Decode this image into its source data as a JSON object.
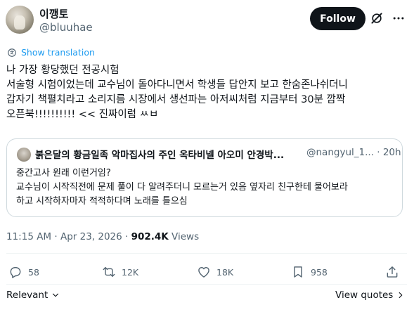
{
  "author": {
    "display_name": "이깽토",
    "handle": "@bluuhae"
  },
  "follow_label": "Follow",
  "translation_label": "Show translation",
  "tweet_lines": [
    "나 가장 황당했던 전공시험",
    "서술형 시험이었는데 교수님이 돌아다니면서 학생들 답안지 보고 한숨존나쉬더니",
    "갑자기 책펼치라고 소리지름 시장에서 생선파는 아저씨처럼 지금부터 30분 깜짝",
    "오픈북!!!!!!!!!! << 진짜이럼 ㅆㅂ"
  ],
  "quote": {
    "author": "붉은달의 황금일족 악마집사의 주인 옥타비넬 아오미 안경박...",
    "handle_time": "@nangyul_1... · 20h",
    "lines": [
      "중간고사 원래 이런거임?",
      "교수님이 시작직전에 문제 풀이 다 알려주더니 모르는거 있음 옆자리 친구한테 물어보라",
      "하고 시작하자마자 적적하다며 노래를 틀으심"
    ]
  },
  "meta": {
    "timestamp": "11:15 AM · Apr 23, 2026 · ",
    "views_count": "902.4K",
    "views_label": " Views"
  },
  "actions": {
    "replies": "58",
    "reposts": "12K",
    "likes": "18K",
    "bookmarks": "958"
  },
  "footer": {
    "sort_label": "Relevant",
    "view_quotes_label": "View quotes"
  },
  "icons": [
    "translate-icon",
    "grok-icon",
    "more-icon",
    "reply-icon",
    "repost-icon",
    "like-icon",
    "bookmark-icon",
    "share-icon",
    "chevron-down-icon",
    "chevron-right-icon"
  ],
  "colors": {
    "accent": "#1d9bf0",
    "text": "#0f1419",
    "muted": "#536471",
    "border": "#cfd9de"
  }
}
